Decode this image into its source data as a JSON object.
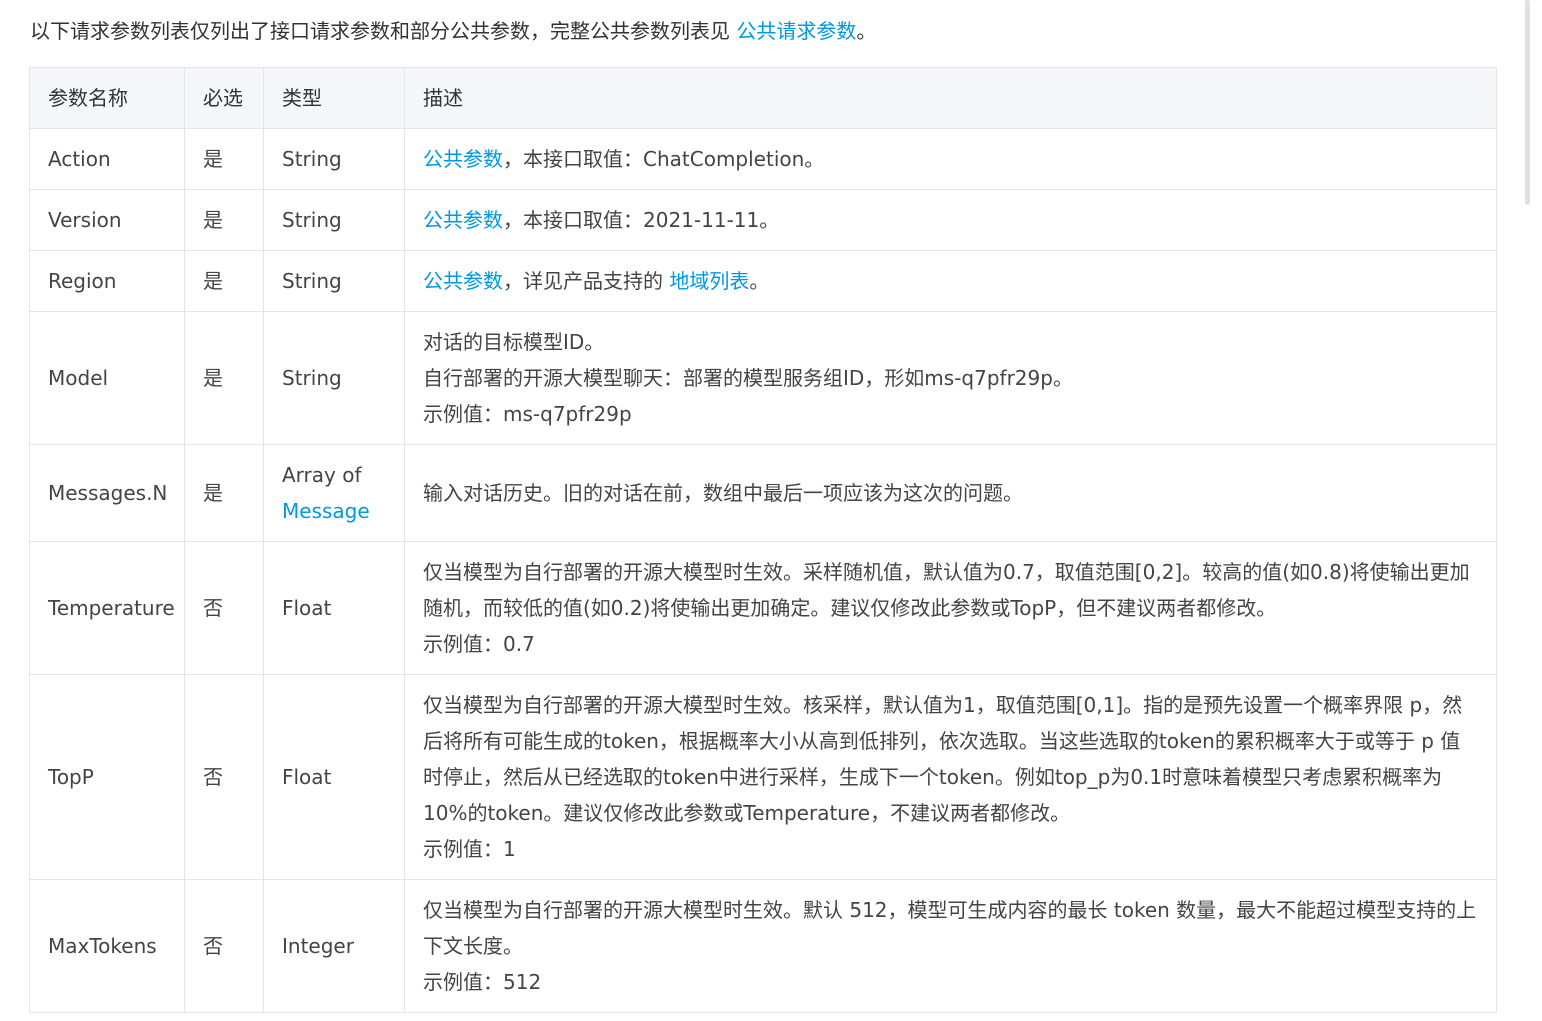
{
  "intro": {
    "text": "以下请求参数列表仅列出了接口请求参数和部分公共参数，完整公共参数列表见 ",
    "link": "公共请求参数",
    "suffix": "。"
  },
  "table": {
    "headers": [
      "参数名称",
      "必选",
      "类型",
      "描述"
    ],
    "rows": [
      {
        "name": "Action",
        "required": "是",
        "type": "String",
        "desc_link": "公共参数",
        "desc": "，本接口取值：ChatCompletion。"
      },
      {
        "name": "Version",
        "required": "是",
        "type": "String",
        "desc_link": "公共参数",
        "desc": "，本接口取值：2021-11-11。"
      },
      {
        "name": "Region",
        "required": "是",
        "type": "String",
        "desc_link": "公共参数",
        "desc": "，详见产品支持的 ",
        "desc_link2": "地域列表",
        "desc_suffix": "。"
      },
      {
        "name": "Model",
        "required": "是",
        "type": "String",
        "desc_lines": [
          "对话的目标模型ID。",
          "自行部署的开源大模型聊天：部署的模型服务组ID，形如ms-q7pfr29p。"
        ],
        "example": "示例值：ms-q7pfr29p"
      },
      {
        "name": "Messages.N",
        "required": "是",
        "type": "Array of",
        "type_link": "Message",
        "desc": "输入对话历史。旧的对话在前，数组中最后一项应该为这次的问题。"
      },
      {
        "name": "Temperature",
        "required": "否",
        "type": "Float",
        "desc": "仅当模型为自行部署的开源大模型时生效。采样随机值，默认值为0.7，取值范围[0,2]。较高的值(如0.8)将使输出更加随机，而较低的值(如0.2)将使输出更加确定。建议仅修改此参数或TopP，但不建议两者都修改。",
        "example": "示例值：0.7"
      },
      {
        "name": "TopP",
        "required": "否",
        "type": "Float",
        "desc": "仅当模型为自行部署的开源大模型时生效。核采样，默认值为1，取值范围[0,1]。指的是预先设置一个概率界限 p，然后将所有可能生成的token，根据概率大小从高到低排列，依次选取。当这些选取的token的累积概率大于或等于 p 值时停止，然后从已经选取的token中进行采样，生成下一个token。例如top_p为0.1时意味着模型只考虑累积概率为10%的token。建议仅修改此参数或Temperature，不建议两者都修改。",
        "example": "示例值：1"
      },
      {
        "name": "MaxTokens",
        "required": "否",
        "type": "Integer",
        "desc": "仅当模型为自行部署的开源大模型时生效。默认 512，模型可生成内容的最长 token 数量，最大不能超过模型支持的上下文长度。",
        "example": "示例值：512"
      }
    ]
  }
}
